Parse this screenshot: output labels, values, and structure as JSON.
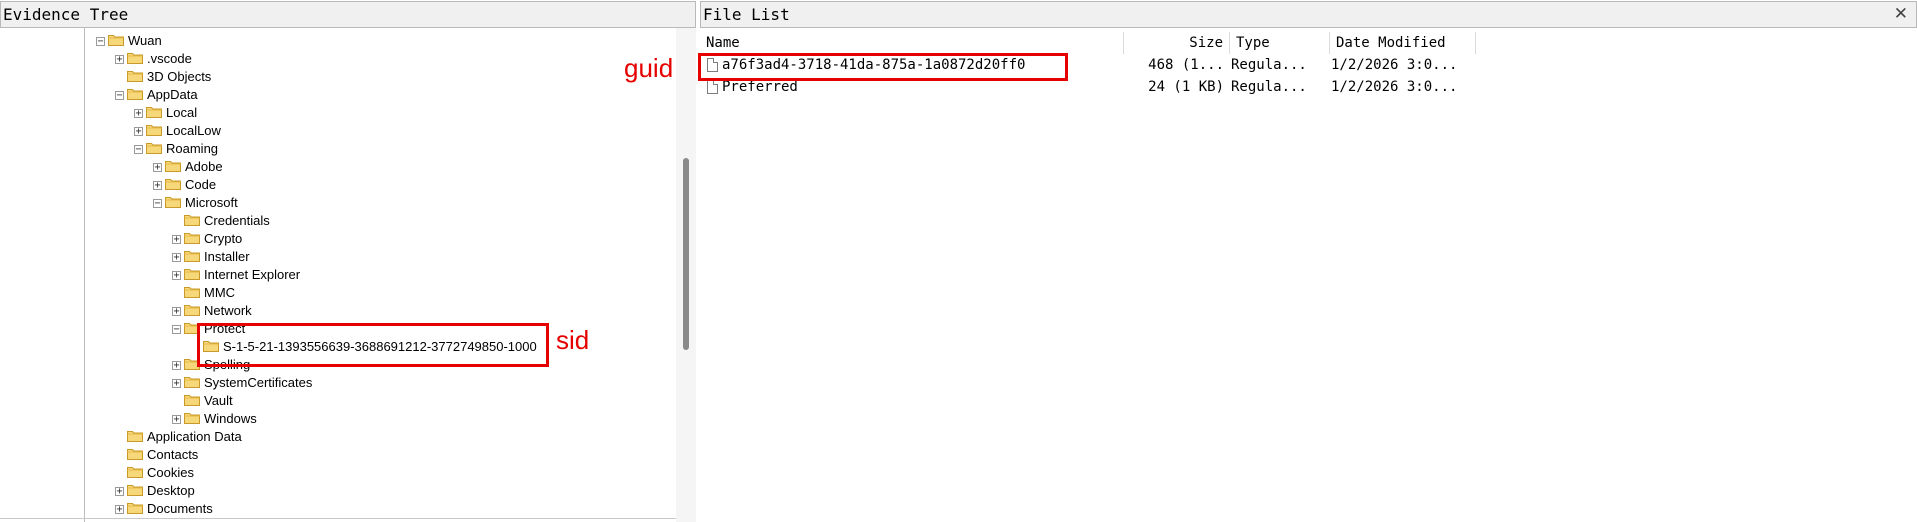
{
  "tree_panel": {
    "title": "Evidence Tree"
  },
  "list_panel": {
    "title": "File List",
    "close_glyph": "✕"
  },
  "tree": [
    {
      "label": "Wuan",
      "expander": "−"
    },
    {
      "label": ".vscode",
      "expander": "+"
    },
    {
      "label": "3D Objects",
      "expander": ""
    },
    {
      "label": "AppData",
      "expander": "−"
    },
    {
      "label": "Local",
      "expander": "+"
    },
    {
      "label": "LocalLow",
      "expander": "+"
    },
    {
      "label": "Roaming",
      "expander": "−"
    },
    {
      "label": "Adobe",
      "expander": "+"
    },
    {
      "label": "Code",
      "expander": "+"
    },
    {
      "label": "Microsoft",
      "expander": "−"
    },
    {
      "label": "Credentials",
      "expander": ""
    },
    {
      "label": "Crypto",
      "expander": "+"
    },
    {
      "label": "Installer",
      "expander": "+"
    },
    {
      "label": "Internet Explorer",
      "expander": "+"
    },
    {
      "label": "MMC",
      "expander": ""
    },
    {
      "label": "Network",
      "expander": "+"
    },
    {
      "label": "Protect",
      "expander": "−"
    },
    {
      "label": "S-1-5-21-1393556639-3688691212-3772749850-1000",
      "expander": ""
    },
    {
      "label": "Spelling",
      "expander": "+"
    },
    {
      "label": "SystemCertificates",
      "expander": "+"
    },
    {
      "label": "Vault",
      "expander": ""
    },
    {
      "label": "Windows",
      "expander": "+"
    },
    {
      "label": "Application Data",
      "expander": ""
    },
    {
      "label": "Contacts",
      "expander": ""
    },
    {
      "label": "Cookies",
      "expander": ""
    },
    {
      "label": "Desktop",
      "expander": "+"
    },
    {
      "label": "Documents",
      "expander": "+"
    }
  ],
  "columns": {
    "name": "Name",
    "size": "Size",
    "type": "Type",
    "date": "Date Modified"
  },
  "files": [
    {
      "name": "a76f3ad4-3718-41da-875a-1a0872d20ff0",
      "size": "468 (1...",
      "type": "Regula...",
      "date": "1/2/2026 3:0..."
    },
    {
      "name": "Preferred",
      "size": "24 (1 KB)",
      "type": "Regula...",
      "date": "1/2/2026 3:0..."
    }
  ],
  "annotations": {
    "guid_label": "guid",
    "sid_label": "sid",
    "color": "#e60000"
  },
  "icons": {
    "folder": "folder-icon",
    "file": "file-icon"
  }
}
